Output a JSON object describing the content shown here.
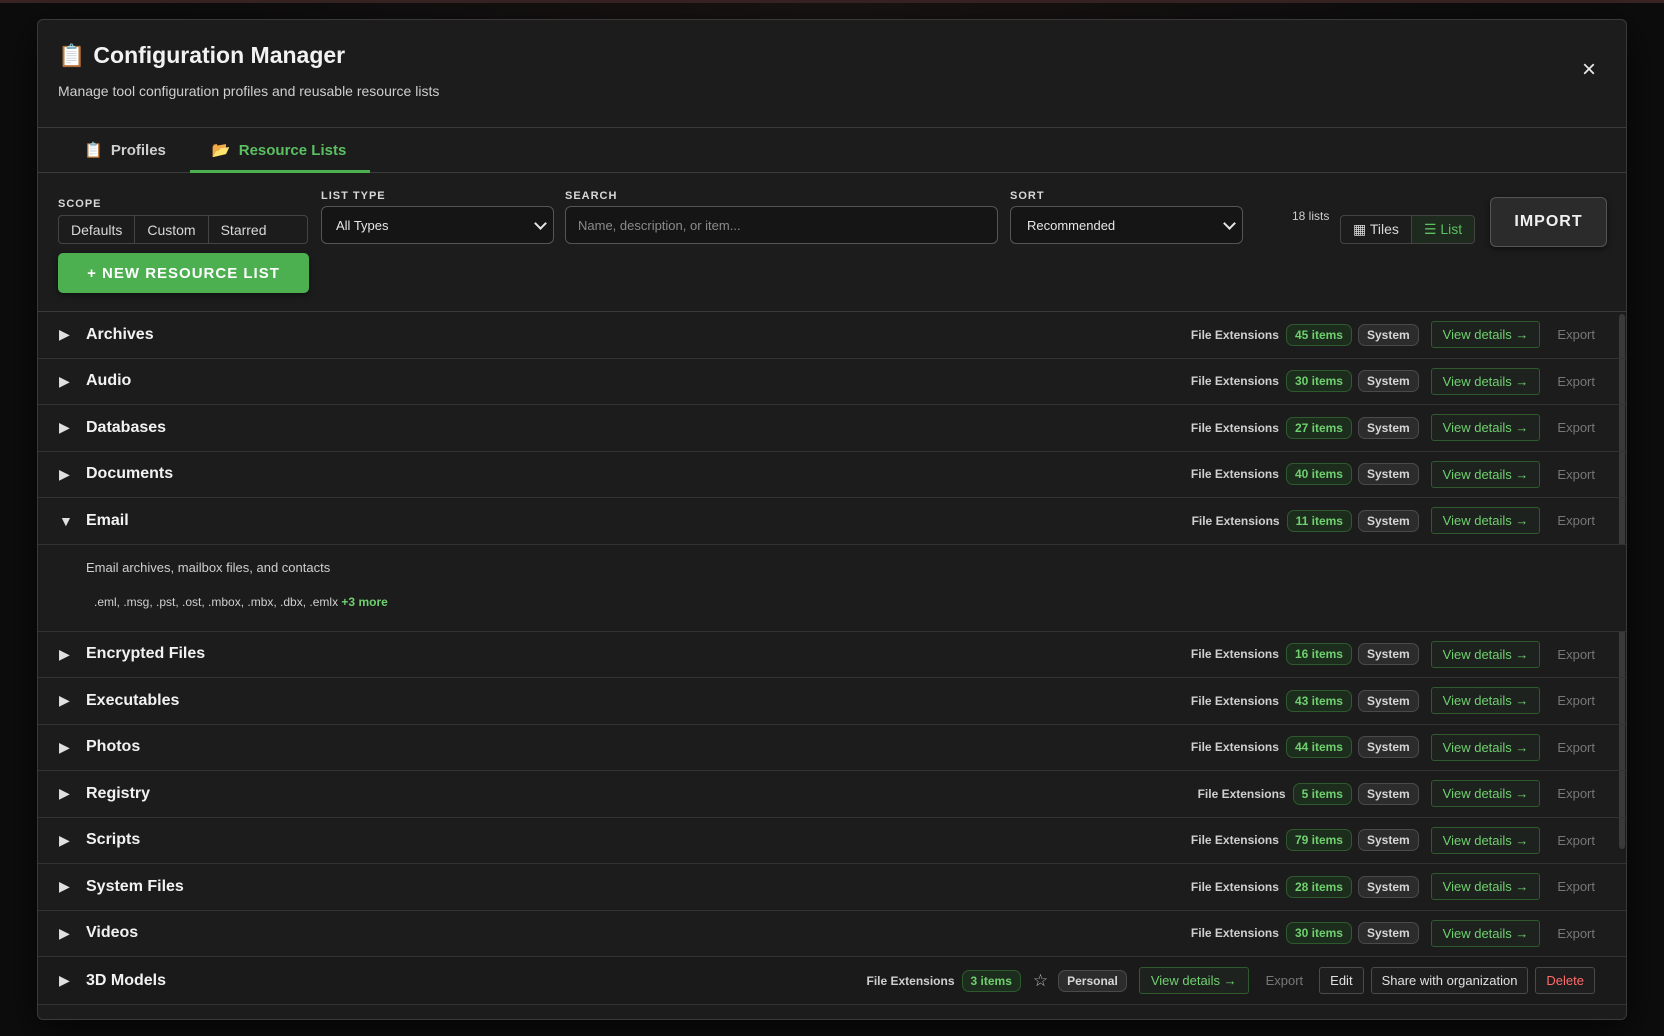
{
  "header": {
    "title": "Configuration Manager",
    "subtitle": "Manage tool configuration profiles and reusable resource lists",
    "close_label": "×"
  },
  "tabs": [
    {
      "icon": "📋",
      "label": "Profiles",
      "active": false
    },
    {
      "icon": "📂",
      "label": "Resource Lists",
      "active": true
    }
  ],
  "toolbar": {
    "scope_label": "SCOPE",
    "scope_options": [
      "Defaults",
      "Custom",
      "Starred"
    ],
    "list_type_label": "LIST TYPE",
    "list_type_value": "All Types",
    "search_label": "SEARCH",
    "search_placeholder": "Name, description, or item...",
    "sort_label": "SORT",
    "sort_value": "Recommended",
    "count": "18 lists",
    "view_tiles": "▦ Tiles",
    "view_list": "☰ List",
    "import_label": "IMPORT",
    "new_label": "+ NEW RESOURCE LIST"
  },
  "rows": [
    {
      "name": "Archives",
      "type": "File Extensions",
      "items": "45 items",
      "owner": "System",
      "expanded": false
    },
    {
      "name": "Audio",
      "type": "File Extensions",
      "items": "30 items",
      "owner": "System",
      "expanded": false
    },
    {
      "name": "Databases",
      "type": "File Extensions",
      "items": "27 items",
      "owner": "System",
      "expanded": false
    },
    {
      "name": "Documents",
      "type": "File Extensions",
      "items": "40 items",
      "owner": "System",
      "expanded": false
    },
    {
      "name": "Email",
      "type": "File Extensions",
      "items": "11 items",
      "owner": "System",
      "expanded": true,
      "description": "Email archives, mailbox files, and contacts",
      "extensions": ".eml, .msg, .pst, .ost, .mbox, .mbx, .dbx, .emlx",
      "more": "+3 more"
    },
    {
      "name": "Encrypted Files",
      "type": "File Extensions",
      "items": "16 items",
      "owner": "System",
      "expanded": false
    },
    {
      "name": "Executables",
      "type": "File Extensions",
      "items": "43 items",
      "owner": "System",
      "expanded": false
    },
    {
      "name": "Photos",
      "type": "File Extensions",
      "items": "44 items",
      "owner": "System",
      "expanded": false
    },
    {
      "name": "Registry",
      "type": "File Extensions",
      "items": "5 items",
      "owner": "System",
      "expanded": false
    },
    {
      "name": "Scripts",
      "type": "File Extensions",
      "items": "79 items",
      "owner": "System",
      "expanded": false
    },
    {
      "name": "System Files",
      "type": "File Extensions",
      "items": "28 items",
      "owner": "System",
      "expanded": false
    },
    {
      "name": "Videos",
      "type": "File Extensions",
      "items": "30 items",
      "owner": "System",
      "expanded": false
    }
  ],
  "last_row": {
    "name": "3D Models",
    "type": "File Extensions",
    "items": "3 items",
    "star": "☆",
    "owner": "Personal",
    "edit": "Edit",
    "share": "Share with organization",
    "delete": "Delete"
  },
  "row_labels": {
    "view": "View details →",
    "export": "Export",
    "collapsed": "▶",
    "expanded": "▼"
  }
}
